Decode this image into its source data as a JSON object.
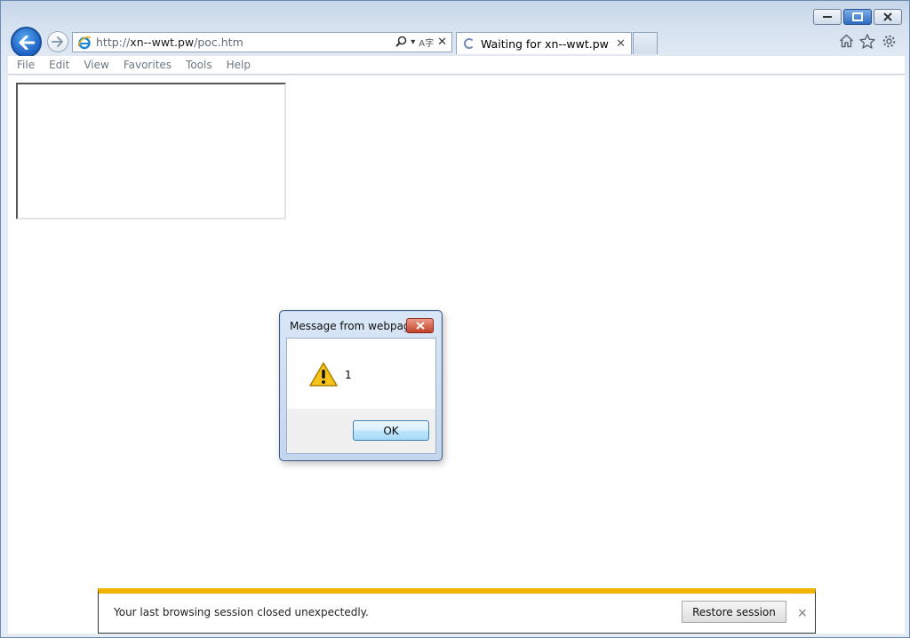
{
  "window": {
    "minimize_label": "",
    "maximize_label": "",
    "close_label": ""
  },
  "address": {
    "url_prefix": "http://",
    "url_domain": "xn--wwt.pw",
    "url_path": "/poc.htm",
    "search_glyph": "⚲",
    "dropdown_glyph": "▾",
    "compat_glyph": "A字",
    "stop_glyph": "✕"
  },
  "tab": {
    "title": "Waiting for xn--wwt.pw",
    "close_glyph": "✕"
  },
  "menu": {
    "items": [
      "File",
      "Edit",
      "View",
      "Favorites",
      "Tools",
      "Help"
    ]
  },
  "dialog": {
    "title": "Message from webpage",
    "message": "1",
    "ok_label": "OK",
    "close_glyph": "✕"
  },
  "notification": {
    "message": "Your last browsing session closed unexpectedly.",
    "restore_label": "Restore session",
    "close_glyph": "×"
  },
  "colors": {
    "accent_blue": "#1b62c2",
    "notification_bar": "#f0b400",
    "dialog_close": "#c4412a"
  },
  "icons": {
    "back": "back-arrow-icon",
    "forward": "forward-arrow-icon",
    "ie": "ie-logo-icon",
    "home": "home-icon",
    "favorites": "star-icon",
    "settings": "gear-icon",
    "warning": "warning-icon"
  }
}
